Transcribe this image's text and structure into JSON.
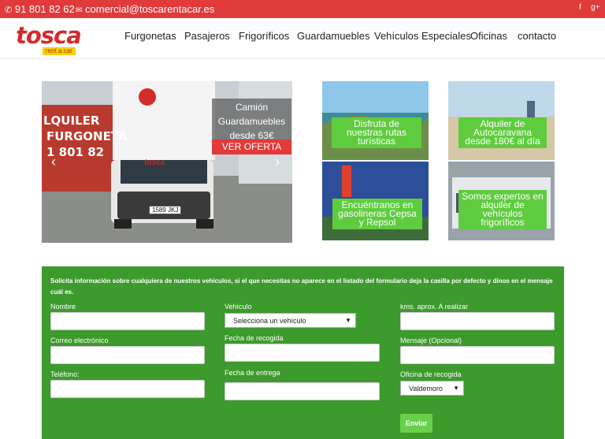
{
  "topbar": {
    "phone": "91 801 82 62",
    "email": "comercial@toscarentacar.es",
    "social": [
      "facebook-icon",
      "google-plus-icon"
    ],
    "facebook": "f",
    "gplus": "g+"
  },
  "logo": {
    "word": "tosca",
    "sub": "rent a car"
  },
  "nav": [
    "Furgonetas",
    "Pasajeros",
    "Frigoríficos",
    "Guardamuebles",
    "Vehículos Especiales",
    "Oficinas",
    "contacto"
  ],
  "slider": {
    "sign_line1": "LQUILER",
    "sign_line2": "FURGONETA",
    "sign_line3": "1 801 82",
    "van_brand": "tosca",
    "plate": "1589 JKJ",
    "caption_line1": "Camión",
    "caption_line2": "Guardamuebles",
    "caption_line3": "desde 63€",
    "cta": "VER OFERTA"
  },
  "tiles": [
    {
      "lines": [
        "Disfruta de",
        "nuestras rutas",
        "turísticas"
      ]
    },
    {
      "lines": [
        "Alquiler de",
        "Autocaravana",
        "desde 180€ al día"
      ]
    },
    {
      "lines": [
        "Encuéntranos en",
        "gasolineras Cepsa",
        "y Repsol"
      ]
    },
    {
      "lines": [
        "Somos expertos en",
        "alquiler de",
        "vehículos",
        "frigoríficos"
      ]
    }
  ],
  "form": {
    "intro": "Solicita información sobre cualquiera de nuestros vehículos, si el que necesitas no aparece en el listado del formulario deja la casilla por defecto y dinos en el mensaje cuál es.",
    "nombre": "Nombre",
    "correo": "Correo electrónico",
    "telefono": "Teléfono:",
    "vehiculo": "Vehículo",
    "vehiculo_value": "Selecciona un vehículo",
    "fecha_recogida": "Fecha de recogida",
    "fecha_entrega": "Fecha de entrega",
    "kms": "kms. aprox. A realizar",
    "mensaje": "Mensaje (Opcional)",
    "oficina": "Oficina de recogida",
    "oficina_value": "Valdemoro",
    "submit": "Enviar"
  }
}
